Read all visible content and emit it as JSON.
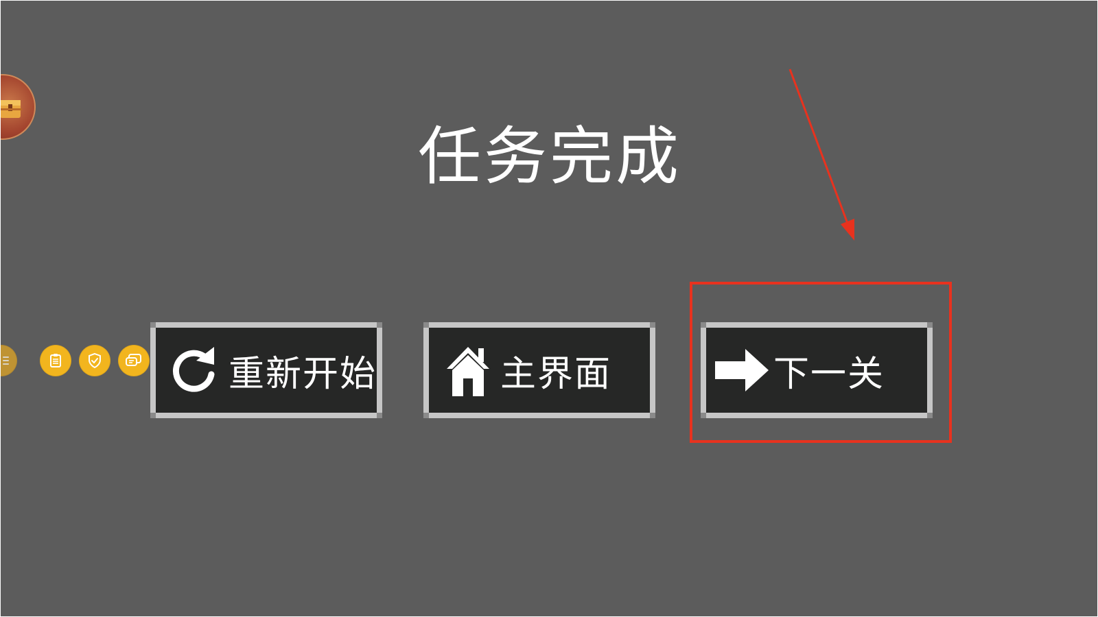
{
  "title": "任务完成",
  "buttons": {
    "restart": {
      "label": "重新开始",
      "icon": "refresh-icon"
    },
    "home": {
      "label": "主界面",
      "icon": "home-icon"
    },
    "next": {
      "label": "下一关",
      "icon": "arrow-right-icon"
    }
  },
  "side_icons": [
    "menu-icon",
    "clipboard-icon",
    "shield-check-icon",
    "chat-icon"
  ],
  "avatar_icon": "treasure-chest-icon",
  "colors": {
    "background": "#5c5c5c",
    "button_face": "#262726",
    "button_frame": "#c6c6c6",
    "side_icon": "#f2b51e",
    "annotation": "#e8321e"
  }
}
